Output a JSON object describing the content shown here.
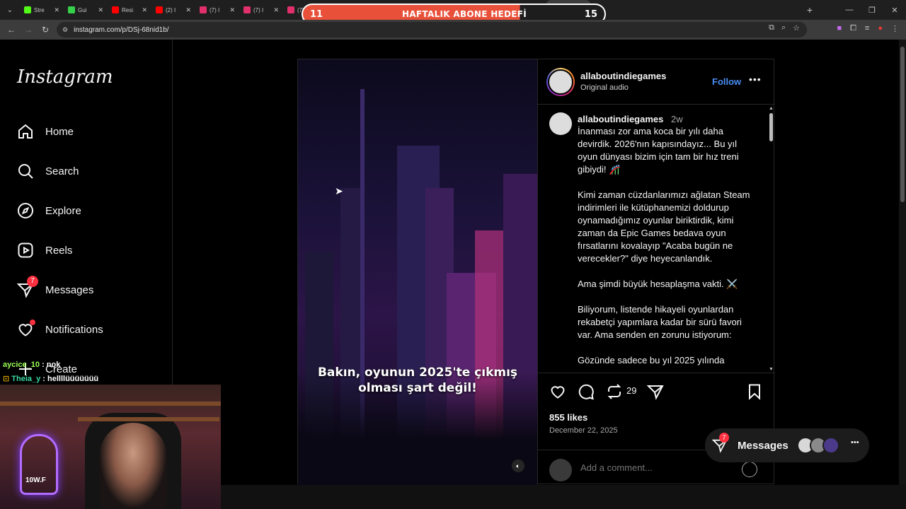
{
  "browser": {
    "tabs": [
      {
        "label": "Stre",
        "color": "#53fc18",
        "active": false
      },
      {
        "label": "Gui",
        "color": "#36d14b",
        "active": false
      },
      {
        "label": "Resi",
        "color": "#ff0000",
        "active": false
      },
      {
        "label": "(2) I",
        "color": "#ff0000",
        "active": false
      },
      {
        "label": "(7) I",
        "color": "#e1306c",
        "active": false
      },
      {
        "label": "(7) I",
        "color": "#e1306c",
        "active": false
      },
      {
        "label": "(7) I",
        "color": "#e1306c",
        "active": false
      },
      {
        "label": "(7) I",
        "color": "#e1306c",
        "active": false
      },
      {
        "label": "(7) I",
        "color": "#e1306c",
        "active": false
      },
      {
        "label": "(7) I",
        "color": "#e1306c",
        "active": false
      },
      {
        "label": "(7) I",
        "color": "#e1306c",
        "active": false
      },
      {
        "label": "(7) I",
        "color": "#e1306c",
        "active": false
      },
      {
        "label": "",
        "color": "#e1306c",
        "active": true
      }
    ],
    "url": "instagram.com/p/DSj-68nid1b/"
  },
  "stream_overlay": {
    "left_number": "11",
    "title": "HAFTALIK ABONE HEDEFİ",
    "right_number": "15",
    "progress": 0.72
  },
  "sidebar": {
    "logo": "Instagram",
    "items": [
      {
        "label": "Home",
        "icon": "home-icon"
      },
      {
        "label": "Search",
        "icon": "search-icon"
      },
      {
        "label": "Explore",
        "icon": "compass-icon"
      },
      {
        "label": "Reels",
        "icon": "reels-icon"
      },
      {
        "label": "Messages",
        "icon": "messenger-icon",
        "badge": "7"
      },
      {
        "label": "Notifications",
        "icon": "heart-icon"
      },
      {
        "label": "Create",
        "icon": "plus-icon"
      }
    ]
  },
  "stream_chat": [
    {
      "user": "aycice_10",
      "message": "nok"
    },
    {
      "user": "Theia_y",
      "message": "hellllüüüüüüü"
    }
  ],
  "webcam": {
    "sign": "10W.F"
  },
  "post": {
    "username": "allaboutindiegames",
    "audio": "Original audio",
    "follow_label": "Follow",
    "video_caption": "Bakın, oyunun 2025'te çıkmış olması şart değil!",
    "caption_time": "2w",
    "caption_paragraphs": [
      "İnanması zor ama koca bir yılı daha devirdik. 2026'nın kapısındayız... Bu yıl oyun dünyası bizim için tam bir hız treni gibiydi! 🎢",
      "Kimi zaman cüzdanlarımızı ağlatan Steam indirimleri ile kütüphanemizi doldurup oynamadığımız oyunlar biriktirdik, kimi zaman da Epic Games bedava oyun fırsatlarını kovalayıp \"Acaba bugün ne verecekler?\" diye heyecanlandık.",
      "Ama şimdi büyük hesaplaşma vakti. ⚔️",
      "Biliyorum, listende hikayeli oyunlardan rekabetçi yapımlara kadar bir sürü favori var. Ama senden en zorunu istiyorum:",
      "Gözünde sadece bu yıl 2025 yılında"
    ],
    "repost_count": "29",
    "likes": "855 likes",
    "date": "December 22, 2025",
    "comment_placeholder": "Add a comment..."
  },
  "messages_pill": {
    "label": "Messages",
    "badge": "7"
  }
}
